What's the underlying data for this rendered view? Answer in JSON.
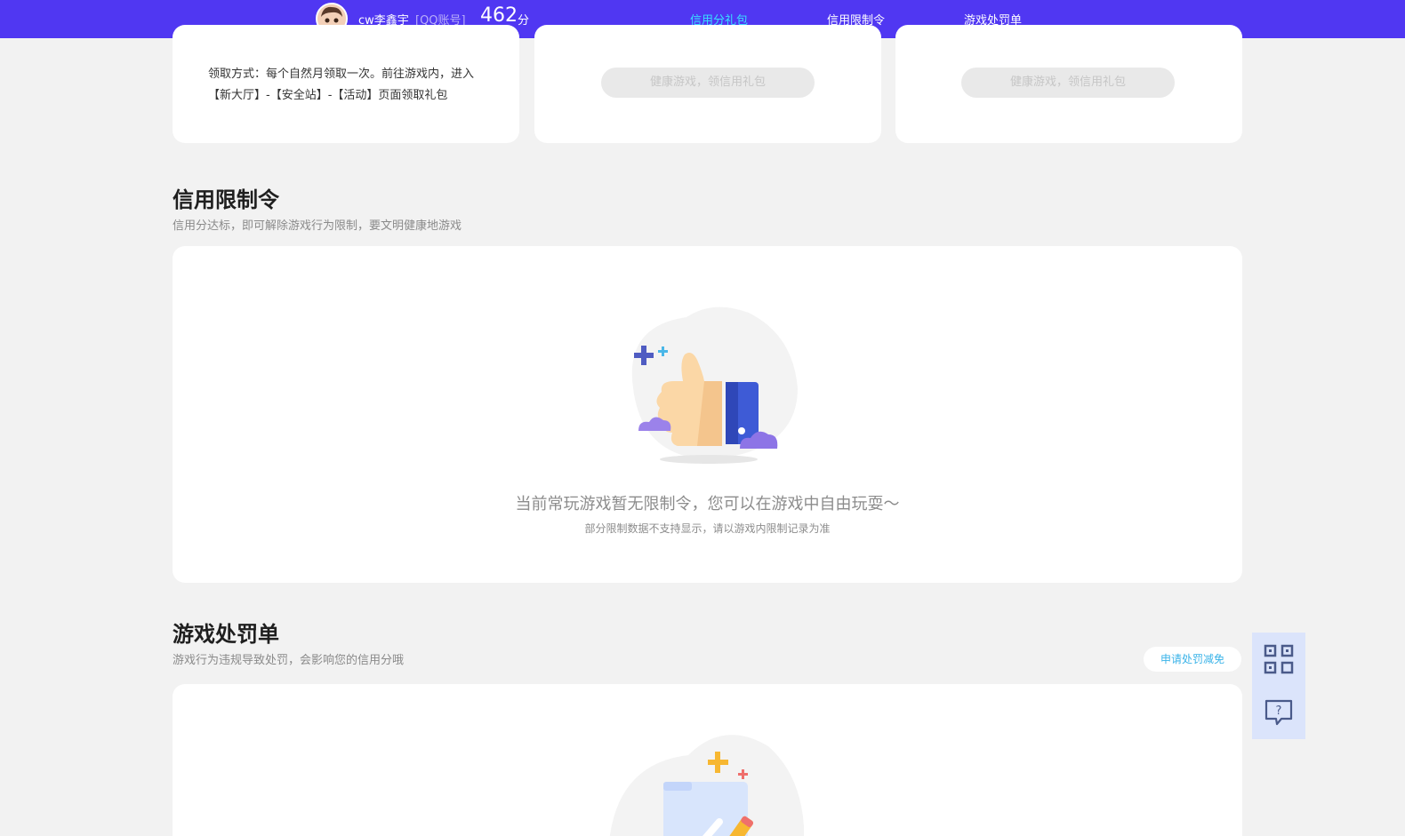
{
  "header": {
    "username": "cw李鑫宇",
    "account_type": "[QQ账号]",
    "score": "462",
    "score_unit": "分",
    "nav": [
      {
        "label": "信用分礼包",
        "active": true
      },
      {
        "label": "信用限制令",
        "active": false
      },
      {
        "label": "游戏处罚单",
        "active": false
      }
    ]
  },
  "gift_cards": {
    "claim_text": "领取方式：每个自然月领取一次。前往游戏内，进入【新大厅】-【安全站】-【活动】页面领取礼包",
    "button_label_2": "健康游戏，领信用礼包",
    "button_label_3": "健康游戏，领信用礼包"
  },
  "restriction": {
    "title": "信用限制令",
    "subtitle": "信用分达标，即可解除游戏行为限制，要文明健康地游戏",
    "empty_main": "当前常玩游戏暂无限制令，您可以在游戏中自由玩耍～",
    "empty_sub": "部分限制数据不支持显示，请以游戏内限制记录为准"
  },
  "penalty": {
    "title": "游戏处罚单",
    "subtitle": "游戏行为违规导致处罚，会影响您的信用分哦",
    "appeal_button": "申请处罚减免"
  },
  "floating": {
    "qr_icon": "qr-code-icon",
    "feedback_icon": "feedback-question-icon"
  },
  "colors": {
    "header_bg": "#5037f2",
    "nav_active": "#38e0ff",
    "accent_link": "#3ab3e8",
    "float_bg": "#dbe4fb"
  }
}
